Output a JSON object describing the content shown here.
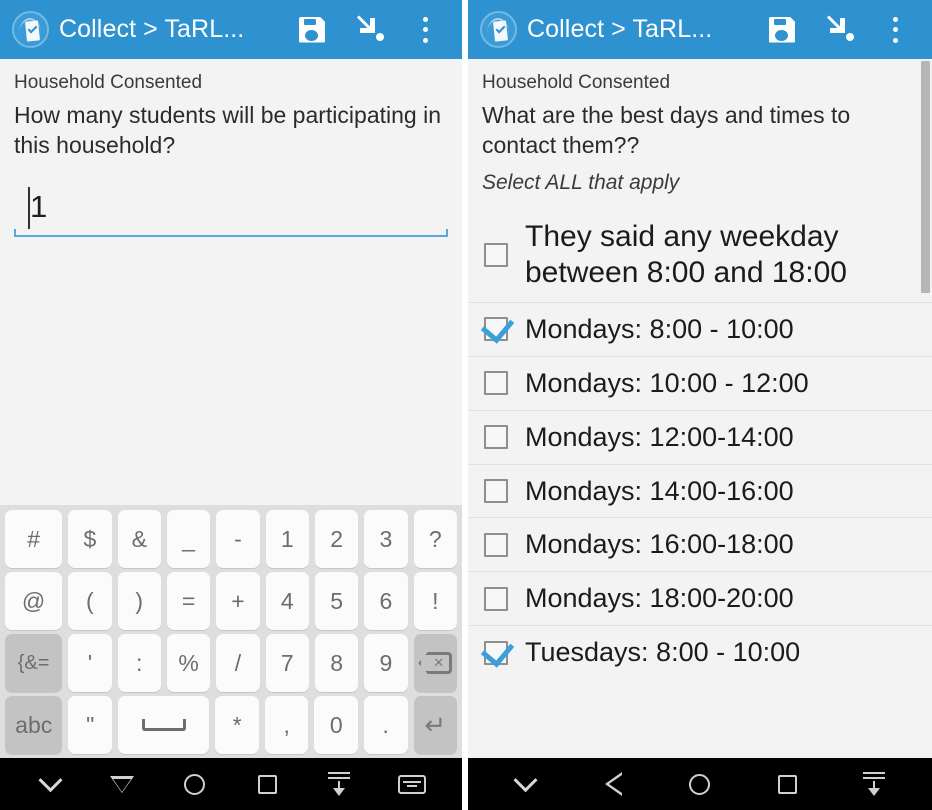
{
  "app": {
    "title": "Collect > TaRL...",
    "logo_icon": "odk-collect-logo",
    "accent_color": "#2e92d1",
    "actions": [
      {
        "name": "save-button",
        "icon": "save-floppy-icon"
      },
      {
        "name": "goto-prompt-button",
        "icon": "cursor-arrow-icon"
      },
      {
        "name": "overflow-menu-button",
        "icon": "more-vertical-icon"
      }
    ]
  },
  "left_screen": {
    "group_label": "Household Consented",
    "question": "How many students will be participating in this household?",
    "input": {
      "value": "1",
      "placeholder": ""
    },
    "keyboard": {
      "rows": [
        [
          {
            "label": "#",
            "type": "char",
            "wide": true
          },
          {
            "label": "$",
            "type": "char"
          },
          {
            "label": "&",
            "type": "char"
          },
          {
            "label": "_",
            "type": "char"
          },
          {
            "label": "-",
            "type": "char"
          },
          {
            "label": "1",
            "type": "char"
          },
          {
            "label": "2",
            "type": "char"
          },
          {
            "label": "3",
            "type": "char"
          },
          {
            "label": "?",
            "type": "char"
          }
        ],
        [
          {
            "label": "@",
            "type": "char",
            "wide": true
          },
          {
            "label": "(",
            "type": "char"
          },
          {
            "label": ")",
            "type": "char"
          },
          {
            "label": "=",
            "type": "char"
          },
          {
            "label": "+",
            "type": "char"
          },
          {
            "label": "4",
            "type": "char"
          },
          {
            "label": "5",
            "type": "char"
          },
          {
            "label": "6",
            "type": "char"
          },
          {
            "label": "!",
            "type": "char"
          }
        ],
        [
          {
            "label": "{&=",
            "type": "fn",
            "wide": true,
            "name": "symbols-toggle-key"
          },
          {
            "label": "'",
            "type": "char"
          },
          {
            "label": ":",
            "type": "char"
          },
          {
            "label": "%",
            "type": "char"
          },
          {
            "label": "/",
            "type": "char"
          },
          {
            "label": "7",
            "type": "char"
          },
          {
            "label": "8",
            "type": "char"
          },
          {
            "label": "9",
            "type": "char"
          },
          {
            "label": "",
            "type": "backspace",
            "name": "backspace-key",
            "icon": "backspace-icon"
          }
        ],
        [
          {
            "label": "abc",
            "type": "fn",
            "wide": true,
            "name": "abc-key"
          },
          {
            "label": "\"",
            "type": "char"
          },
          {
            "label": "",
            "type": "space",
            "name": "space-key",
            "icon": "spacebar-icon"
          },
          {
            "label": "*",
            "type": "char"
          },
          {
            "label": ",",
            "type": "char"
          },
          {
            "label": "0",
            "type": "char"
          },
          {
            "label": ".",
            "type": "char"
          },
          {
            "label": "",
            "type": "enter",
            "name": "enter-key",
            "icon": "enter-icon"
          }
        ]
      ]
    },
    "navbar": [
      {
        "name": "nav-hide-keyboard",
        "icon": "chevron-down-icon"
      },
      {
        "name": "nav-back",
        "icon": "triangle-down-icon"
      },
      {
        "name": "nav-home",
        "icon": "circle-icon"
      },
      {
        "name": "nav-recents",
        "icon": "square-icon"
      },
      {
        "name": "nav-download",
        "icon": "download-arrow-icon"
      },
      {
        "name": "nav-keyboard-switch",
        "icon": "keyboard-icon"
      }
    ]
  },
  "right_screen": {
    "group_label": "Household Consented",
    "question": "What are the best days and times to contact them??",
    "hint": "Select ALL that apply",
    "choices": [
      {
        "label": "They said any weekday between 8:00 and 18:00",
        "checked": false,
        "big": true
      },
      {
        "label": "Mondays: 8:00 - 10:00",
        "checked": true,
        "big": false
      },
      {
        "label": "Mondays: 10:00 - 12:00",
        "checked": false,
        "big": false
      },
      {
        "label": "Mondays: 12:00-14:00",
        "checked": false,
        "big": false
      },
      {
        "label": "Mondays: 14:00-16:00",
        "checked": false,
        "big": false
      },
      {
        "label": "Mondays: 16:00-18:00",
        "checked": false,
        "big": false
      },
      {
        "label": "Mondays: 18:00-20:00",
        "checked": false,
        "big": false
      },
      {
        "label": "Tuesdays: 8:00 - 10:00",
        "checked": true,
        "big": false
      }
    ],
    "navbar": [
      {
        "name": "nav-hide-keyboard",
        "icon": "chevron-down-icon"
      },
      {
        "name": "nav-back",
        "icon": "triangle-left-icon"
      },
      {
        "name": "nav-home",
        "icon": "circle-icon"
      },
      {
        "name": "nav-recents",
        "icon": "square-icon"
      },
      {
        "name": "nav-download",
        "icon": "download-arrow-icon"
      }
    ]
  }
}
